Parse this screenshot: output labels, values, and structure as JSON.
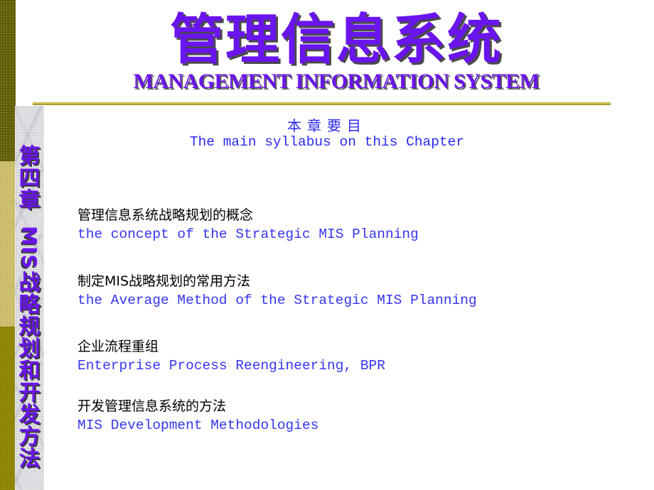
{
  "slide": {
    "title_cn": "管理信息系统",
    "title_en": "MANAGEMENT INFORMATION SYSTEM",
    "side_title": {
      "chapter": [
        "第",
        "四",
        "章"
      ],
      "rotated": "MIS",
      "subject": [
        "战",
        "略",
        "规",
        "划",
        "和",
        "开",
        "发",
        "方",
        "法"
      ]
    },
    "syllabus_heading_cn": "本章要目",
    "syllabus_heading_en": "The main syllabus on this Chapter",
    "topics": [
      {
        "cn": "管理信息系统战略规划的概念",
        "en": "the concept of the Strategic MIS Planning"
      },
      {
        "cn": "制定MIS战略规划的常用方法",
        "en": "the Average Method of the Strategic MIS Planning"
      },
      {
        "cn": "企业流程重组",
        "en": "Enterprise Process Reengineering, BPR"
      },
      {
        "cn": "开发管理信息系统的方法",
        "en": "MIS Development Methodologies"
      }
    ],
    "colors": {
      "title": "#6a14ee",
      "syllabus_text": "#2a2aee",
      "topic_en": "#3636f0",
      "topic_cn": "#000000",
      "separator": "#c9bc4a",
      "strip_dark": "#6b6a0a",
      "strip_khaki": "#d4c776",
      "strip_olive": "#9a9208"
    }
  }
}
